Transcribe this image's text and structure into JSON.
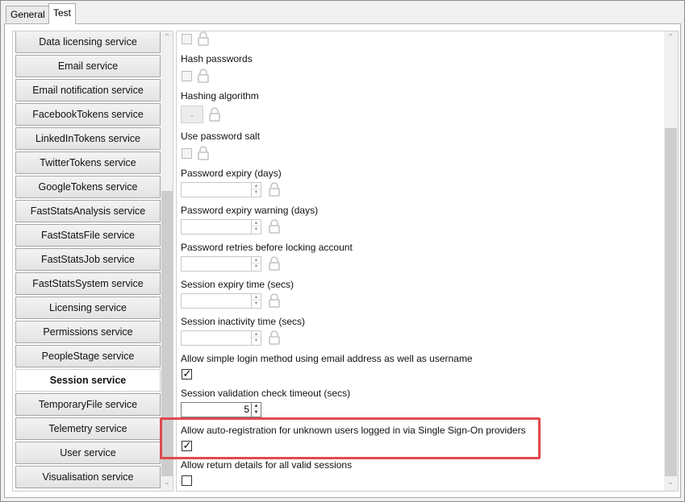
{
  "tabs": [
    {
      "label": "General",
      "selected": false
    },
    {
      "label": "Test",
      "selected": true
    }
  ],
  "services": [
    {
      "label": "Data licensing service"
    },
    {
      "label": "Email service"
    },
    {
      "label": "Email notification service"
    },
    {
      "label": "FacebookTokens service"
    },
    {
      "label": "LinkedInTokens service"
    },
    {
      "label": "TwitterTokens service"
    },
    {
      "label": "GoogleTokens service"
    },
    {
      "label": "FastStatsAnalysis service"
    },
    {
      "label": "FastStatsFile service"
    },
    {
      "label": "FastStatsJob service"
    },
    {
      "label": "FastStatsSystem service"
    },
    {
      "label": "Licensing service"
    },
    {
      "label": "Permissions service"
    },
    {
      "label": "PeopleStage service"
    },
    {
      "label": "Session service",
      "selected": true
    },
    {
      "label": "TemporaryFile service"
    },
    {
      "label": "Telemetry service"
    },
    {
      "label": "User service"
    },
    {
      "label": "Visualisation service"
    }
  ],
  "settings": {
    "top_checkbox": {
      "checked": false,
      "disabled": true
    },
    "hash_passwords": {
      "label": "Hash passwords",
      "checked": false,
      "disabled": true
    },
    "hashing_algorithm": {
      "label": "Hashing algorithm",
      "value": ""
    },
    "use_password_salt": {
      "label": "Use password salt",
      "checked": false,
      "disabled": true
    },
    "password_expiry": {
      "label": "Password expiry (days)",
      "value": ""
    },
    "password_expiry_warning": {
      "label": "Password expiry warning (days)",
      "value": ""
    },
    "password_retries": {
      "label": "Password retries before locking account",
      "value": ""
    },
    "session_expiry": {
      "label": "Session expiry time (secs)",
      "value": ""
    },
    "session_inactivity": {
      "label": "Session inactivity time (secs)",
      "value": ""
    },
    "allow_simple_login": {
      "label": "Allow simple login method using email address as well as username",
      "checked": true
    },
    "session_validation_timeout": {
      "label": "Session validation check timeout (secs)",
      "value": "5"
    },
    "allow_auto_registration": {
      "label": "Allow auto-registration for unknown users logged in via Single Sign-On providers",
      "checked": true
    },
    "allow_return_details": {
      "label": "Allow return details for all valid sessions",
      "checked": false
    }
  },
  "glyphs": {
    "check": "✓",
    "up": "▲",
    "down": "▼",
    "chevron_down": "⌄",
    "scroll_up": "⌃",
    "scroll_down": "⌄"
  },
  "colors": {
    "highlight": "#e04a4f",
    "scroll_thumb": "#cdcdcd"
  }
}
